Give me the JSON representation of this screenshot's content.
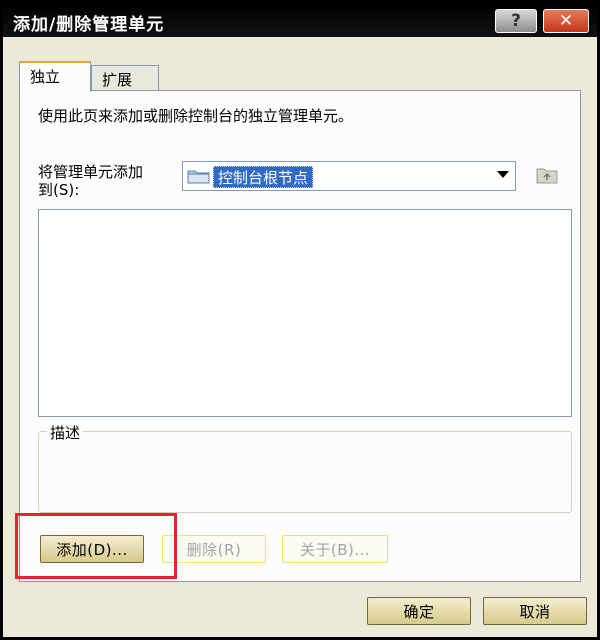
{
  "window": {
    "title": "添加/删除管理单元",
    "help_label": "?",
    "close_label": "✕"
  },
  "tabs": [
    {
      "label": "独立",
      "active": true
    },
    {
      "label": "扩展",
      "active": false
    }
  ],
  "panel": {
    "description": "使用此页来添加或删除控制台的独立管理单元。",
    "add_to_label_line1": "将管理单元添加",
    "add_to_label_line2": "到(S):",
    "combo_value": "控制台根节点",
    "group_title": "描述"
  },
  "buttons": {
    "add": "添加(D)...",
    "remove": "删除(R)",
    "about": "关于(B)...",
    "ok": "确定",
    "cancel": "取消"
  },
  "icons": {
    "combo": "folder-icon",
    "up": "folder-up-icon"
  },
  "colors": {
    "title_bar": "#000000",
    "selection": "#316ac5",
    "highlight_box": "#e4242f"
  }
}
